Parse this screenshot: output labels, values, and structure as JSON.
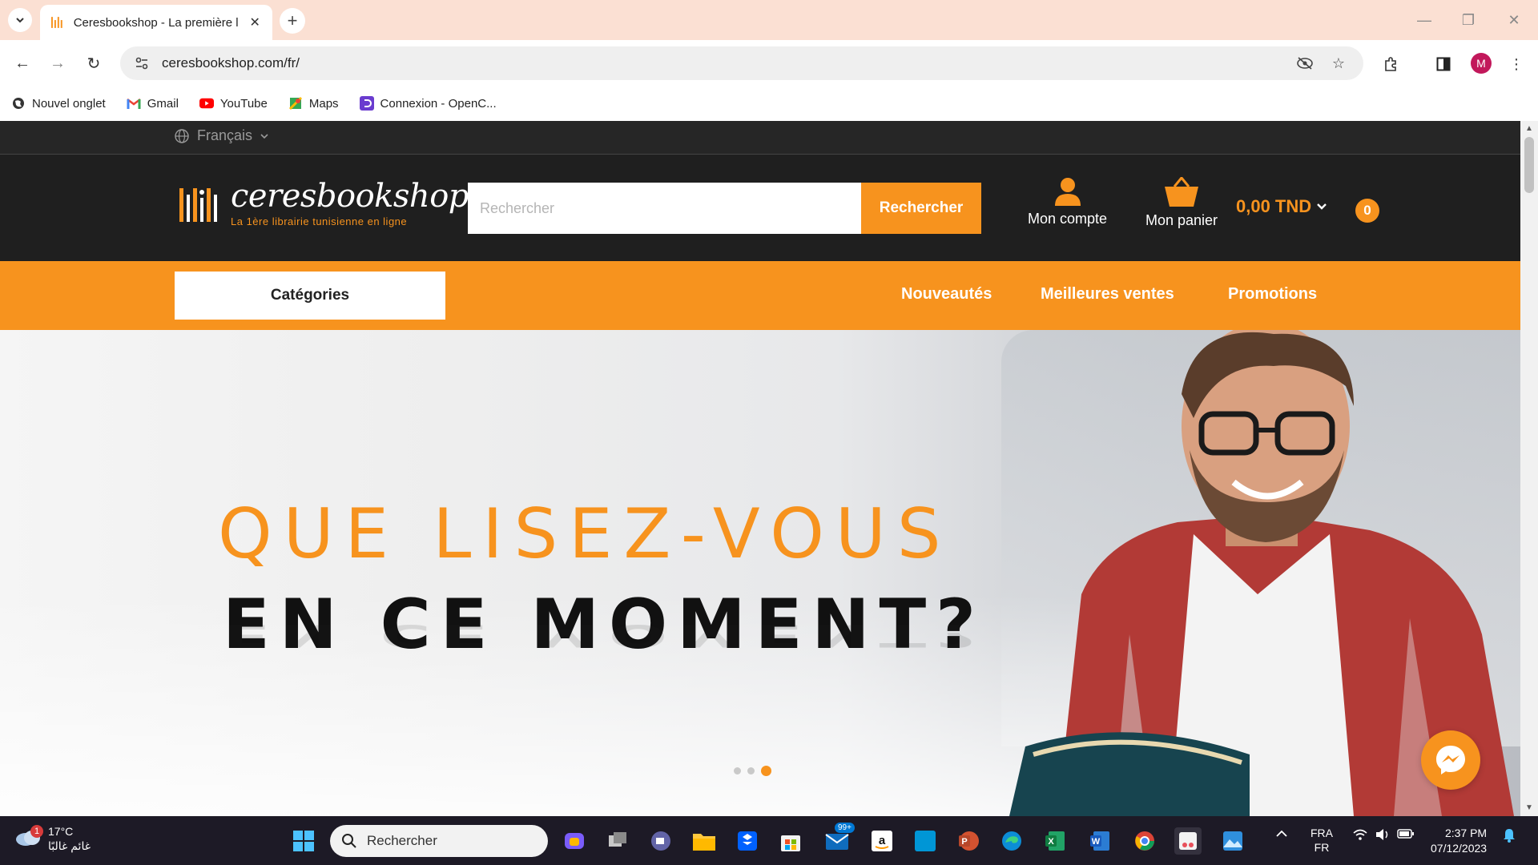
{
  "browser": {
    "tab_title": "Ceresbookshop - La première li",
    "url": "ceresbookshop.com/fr/",
    "bookmarks": [
      {
        "label": "Nouvel onglet",
        "icon": "globe-icon"
      },
      {
        "label": "Gmail",
        "icon": "gmail-icon"
      },
      {
        "label": "YouTube",
        "icon": "youtube-icon"
      },
      {
        "label": "Maps",
        "icon": "maps-icon"
      },
      {
        "label": "Connexion - OpenC...",
        "icon": "opencart-icon"
      }
    ],
    "profile_initial": "M"
  },
  "site": {
    "language": "Français",
    "logo_name": "ceresbookshop",
    "logo_tagline": "La 1ère librairie tunisienne en ligne",
    "search_placeholder": "Rechercher",
    "search_button": "Rechercher",
    "account_label": "Mon compte",
    "cart_label": "Mon panier",
    "cart_total": "0,00 TND",
    "cart_count": "0",
    "categories_button": "Catégories",
    "nav_links": [
      "Nouveautés",
      "Meilleures ventes",
      "Promotions"
    ],
    "hero_line1": "QUE LISEZ-VOUS",
    "hero_line2": "EN CE MOMENT?",
    "slider_active_index": 3,
    "accent_color": "#f7931e"
  },
  "taskbar": {
    "temperature": "17°C",
    "weather_text": "غائم غالبًا",
    "weather_badge": "1",
    "search_placeholder": "Rechercher",
    "mail_badge": "99+",
    "lang_top": "FRA",
    "lang_bottom": "FR",
    "time": "2:37 PM",
    "date": "07/12/2023"
  }
}
